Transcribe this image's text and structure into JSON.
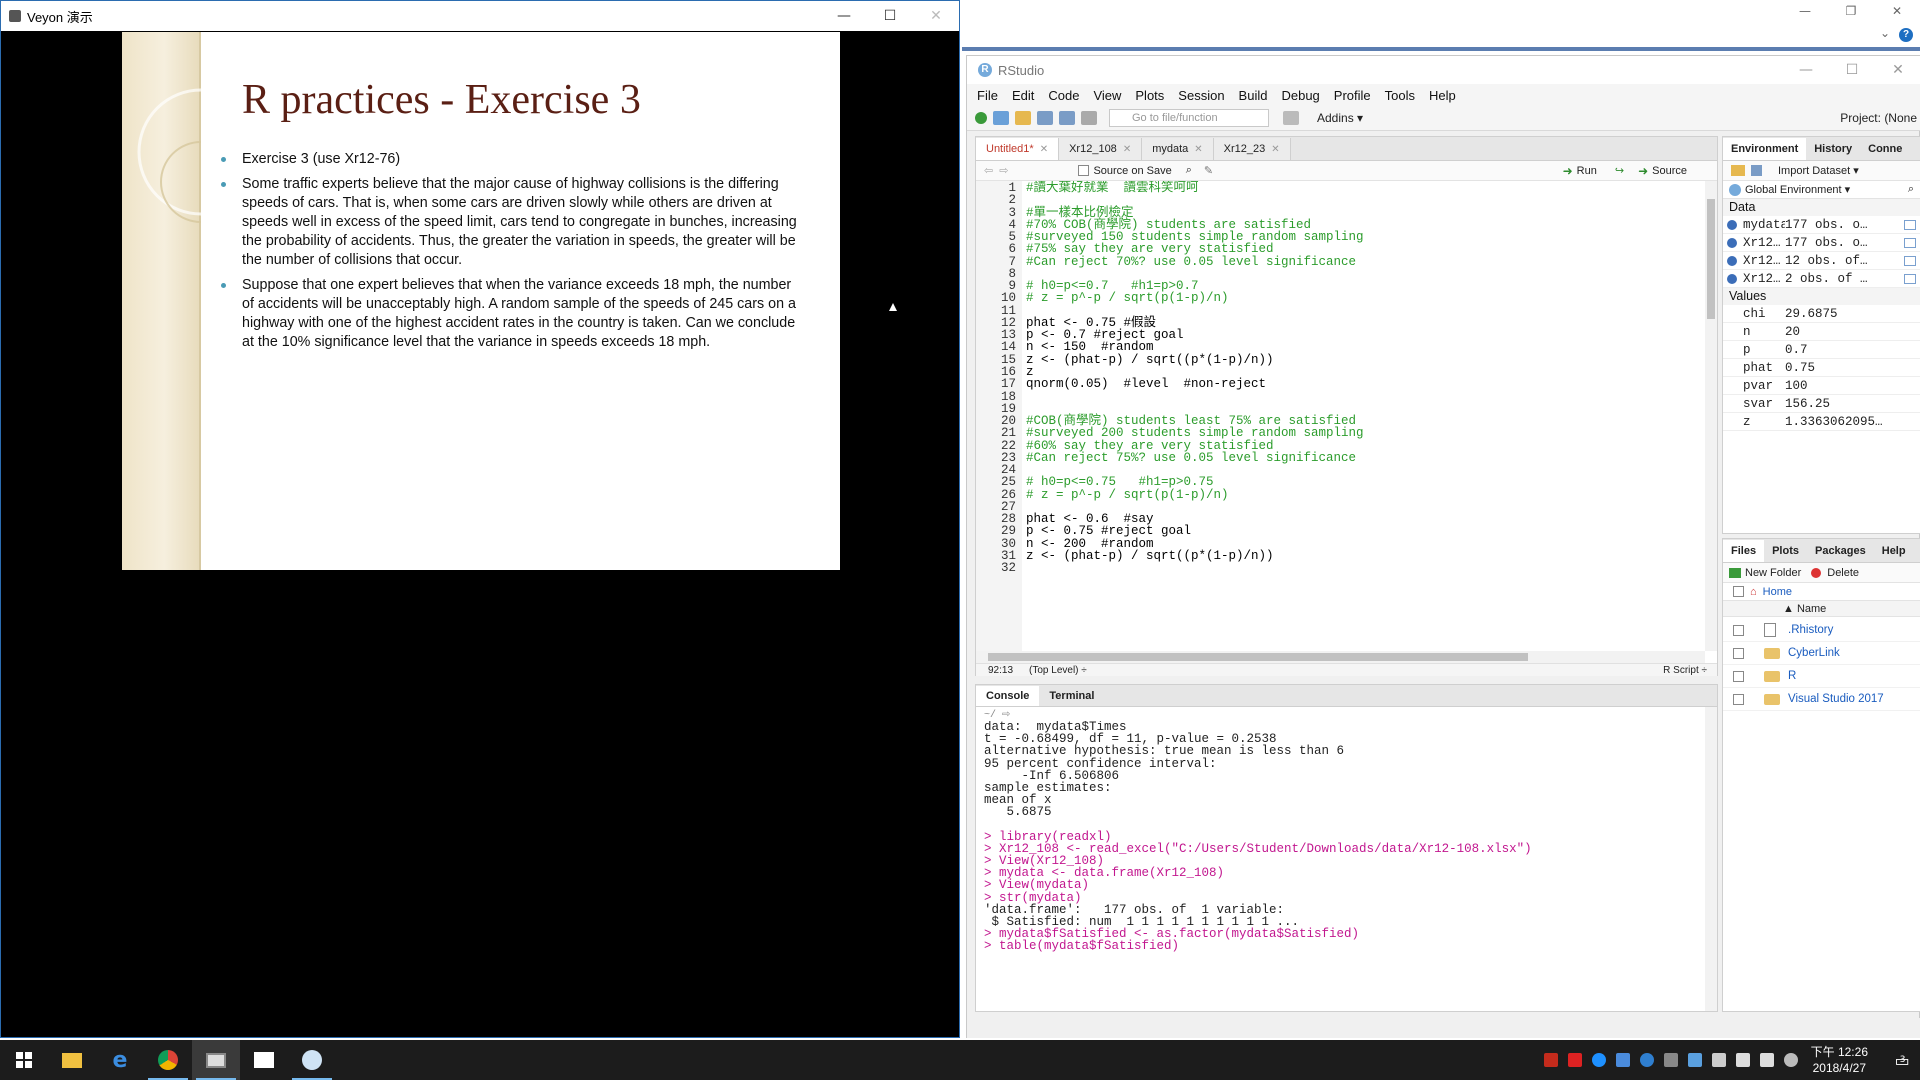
{
  "veyon": {
    "title": "Veyon 演示",
    "controls": [
      "—",
      "☐",
      "✕"
    ],
    "slide": {
      "title": "R practices - Exercise 3",
      "bullets": [
        "Exercise 3 (use Xr12-76)",
        "Some traffic experts believe that the major cause of highway collisions is the differing speeds of cars. That is, when some cars are driven slowly while others are driven at speeds well in excess of the speed limit, cars tend to congregate in bunches, increasing the probability of accidents. Thus, the greater the variation in speeds, the greater will be the number of collisions that occur.",
        "Suppose that one expert believes that when the variance exceeds 18 mph, the number of accidents will be unacceptably high. A random sample of the speeds of 245 cars on a highway with one of the highest accident rates in the country is taken. Can we conclude at the 10% significance level that the variance in speeds exceeds 18 mph."
      ]
    }
  },
  "desktop": {
    "controls": [
      "—",
      "❐",
      "✕"
    ],
    "help_icon": "?",
    "chevron": "⌄"
  },
  "rstudio": {
    "title": "RStudio",
    "logo": "R",
    "menu": [
      "File",
      "Edit",
      "Code",
      "View",
      "Plots",
      "Session",
      "Build",
      "Debug",
      "Profile",
      "Tools",
      "Help"
    ],
    "goto_placeholder": "Go to file/function",
    "addins_label": "Addins ▾",
    "project_label": "Project: (None",
    "window_controls": [
      "—",
      "☐",
      "✕"
    ],
    "source": {
      "tabs": [
        {
          "label": "Untitled1*",
          "active": true
        },
        {
          "label": "Xr12_108",
          "active": false
        },
        {
          "label": "mydata",
          "active": false
        },
        {
          "label": "Xr12_23",
          "active": false
        }
      ],
      "source_on_save": "Source on Save",
      "run_label": "Run",
      "source_label": "Source",
      "lines": [
        {
          "n": "1",
          "t": "#讀大葉好就業  讀雲科笑呵呵",
          "c": "cm"
        },
        {
          "n": "2",
          "t": "",
          "c": "kw"
        },
        {
          "n": "3",
          "t": "#單一樣本比例檢定",
          "c": "cm"
        },
        {
          "n": "4",
          "t": "#70% COB(商學院) students are satisfied",
          "c": "cm"
        },
        {
          "n": "5",
          "t": "#surveyed 150 students simple random sampling",
          "c": "cm"
        },
        {
          "n": "6",
          "t": "#75% say they are very statisfied",
          "c": "cm"
        },
        {
          "n": "7",
          "t": "#Can reject 70%? use 0.05 level significance",
          "c": "cm"
        },
        {
          "n": "8",
          "t": "",
          "c": "kw"
        },
        {
          "n": "9",
          "t": "# h0=p<=0.7   #h1=p>0.7",
          "c": "cm"
        },
        {
          "n": "10",
          "t": "# z = p^-p / sqrt(p(1-p)/n)",
          "c": "cm"
        },
        {
          "n": "11",
          "t": "",
          "c": "kw"
        },
        {
          "n": "12",
          "t": "phat <- 0.75 #假設",
          "c": "mix"
        },
        {
          "n": "13",
          "t": "p <- 0.7 #reject goal",
          "c": "mix"
        },
        {
          "n": "14",
          "t": "n <- 150  #random",
          "c": "mix"
        },
        {
          "n": "15",
          "t": "z <- (phat-p) / sqrt((p*(1-p)/n))",
          "c": "kw"
        },
        {
          "n": "16",
          "t": "z",
          "c": "kw"
        },
        {
          "n": "17",
          "t": "qnorm(0.05)  #level  #non-reject",
          "c": "mix"
        },
        {
          "n": "18",
          "t": "",
          "c": "kw"
        },
        {
          "n": "19",
          "t": "",
          "c": "kw"
        },
        {
          "n": "20",
          "t": "#COB(商學院) students least 75% are satisfied",
          "c": "cm"
        },
        {
          "n": "21",
          "t": "#surveyed 200 students simple random sampling",
          "c": "cm"
        },
        {
          "n": "22",
          "t": "#60% say they are very statisfied",
          "c": "cm"
        },
        {
          "n": "23",
          "t": "#Can reject 75%? use 0.05 level significance",
          "c": "cm"
        },
        {
          "n": "24",
          "t": "",
          "c": "kw"
        },
        {
          "n": "25",
          "t": "# h0=p<=0.75   #h1=p>0.75",
          "c": "cm"
        },
        {
          "n": "26",
          "t": "# z = p^-p / sqrt(p(1-p)/n)",
          "c": "cm"
        },
        {
          "n": "27",
          "t": "",
          "c": "kw"
        },
        {
          "n": "28",
          "t": "phat <- 0.6  #say",
          "c": "mix"
        },
        {
          "n": "29",
          "t": "p <- 0.75 #reject goal",
          "c": "mix"
        },
        {
          "n": "30",
          "t": "n <- 200  #random",
          "c": "mix"
        },
        {
          "n": "31",
          "t": "z <- (phat-p) / sqrt((p*(1-p)/n))",
          "c": "kw"
        },
        {
          "n": "32",
          "t": "",
          "c": "kw"
        }
      ],
      "status_pos": "92:13",
      "status_scope": "(Top Level) ÷",
      "status_type": "R Script ÷"
    },
    "console": {
      "tabs": [
        "Console",
        "Terminal"
      ],
      "path": "~/ ⇨",
      "lines": [
        {
          "t": "data:  mydata$Times",
          "p": false
        },
        {
          "t": "t = -0.68499, df = 11, p-value = 0.2538",
          "p": false
        },
        {
          "t": "alternative hypothesis: true mean is less than 6",
          "p": false
        },
        {
          "t": "95 percent confidence interval:",
          "p": false
        },
        {
          "t": "     -Inf 6.506806",
          "p": false
        },
        {
          "t": "sample estimates:",
          "p": false
        },
        {
          "t": "mean of x",
          "p": false
        },
        {
          "t": "   5.6875",
          "p": false
        },
        {
          "t": "",
          "p": false
        },
        {
          "t": "> library(readxl)",
          "p": true
        },
        {
          "t": "> Xr12_108 <- read_excel(\"C:/Users/Student/Downloads/data/Xr12-108.xlsx\")",
          "p": true
        },
        {
          "t": "> View(Xr12_108)",
          "p": true
        },
        {
          "t": "> mydata <- data.frame(Xr12_108)",
          "p": true
        },
        {
          "t": "> View(mydata)",
          "p": true
        },
        {
          "t": "> str(mydata)",
          "p": true
        },
        {
          "t": "'data.frame':   177 obs. of  1 variable:",
          "p": false
        },
        {
          "t": " $ Satisfied: num  1 1 1 1 1 1 1 1 1 1 ...",
          "p": false
        },
        {
          "t": "> mydata$fSatisfied <- as.factor(mydata$Satisfied)",
          "p": true
        },
        {
          "t": "> table(mydata$fSatisfied)",
          "p": true
        }
      ]
    },
    "environment": {
      "tabs": [
        "Environment",
        "History",
        "Conne"
      ],
      "import_label": "Import Dataset ▾",
      "scope_label": "Global Environment ▾",
      "data_header": "Data",
      "data": [
        {
          "name": "mydata",
          "val": "177 obs. o…"
        },
        {
          "name": "Xr12…",
          "val": "177 obs. o…"
        },
        {
          "name": "Xr12…",
          "val": "12 obs. of…"
        },
        {
          "name": "Xr12…",
          "val": "2 obs. of …"
        }
      ],
      "values_header": "Values",
      "values": [
        {
          "name": "chi",
          "val": "29.6875"
        },
        {
          "name": "n",
          "val": "20"
        },
        {
          "name": "p",
          "val": "0.7"
        },
        {
          "name": "phat",
          "val": "0.75"
        },
        {
          "name": "pvar",
          "val": "100"
        },
        {
          "name": "svar",
          "val": "156.25"
        },
        {
          "name": "z",
          "val": "1.3363062095…"
        }
      ]
    },
    "files": {
      "tabs": [
        "Files",
        "Plots",
        "Packages",
        "Help"
      ],
      "new_folder": "New Folder",
      "delete": "Delete",
      "crumb": "Home",
      "name_header": "▲ Name",
      "items": [
        {
          "name": ".Rhistory",
          "type": "doc"
        },
        {
          "name": "CyberLink",
          "type": "folder"
        },
        {
          "name": "R",
          "type": "folder"
        },
        {
          "name": "Visual Studio 2017",
          "type": "folder"
        }
      ]
    }
  },
  "taskbar": {
    "clock_time": "下午 12:26",
    "clock_date": "2018/4/27",
    "notif_count": "3",
    "apps": [
      "windows-start",
      "file-explorer",
      "internet-explorer",
      "chrome",
      "veyon",
      "photos",
      "rstudio-app"
    ]
  }
}
